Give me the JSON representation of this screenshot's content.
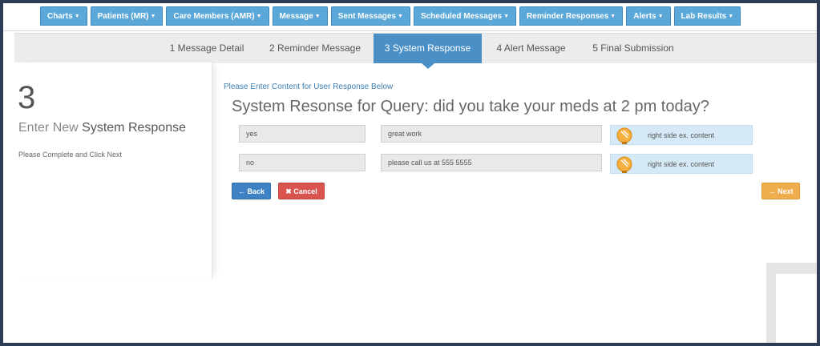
{
  "nav": {
    "items": [
      {
        "label": "Charts"
      },
      {
        "label": "Patients (MR)"
      },
      {
        "label": "Care Members (AMR)"
      },
      {
        "label": "Message"
      },
      {
        "label": "Sent Messages"
      },
      {
        "label": "Scheduled Messages"
      },
      {
        "label": "Reminder Responses"
      },
      {
        "label": "Alerts"
      },
      {
        "label": "Lab Results"
      }
    ]
  },
  "steps": [
    {
      "label": "1 Message Detail"
    },
    {
      "label": "2 Reminder Message"
    },
    {
      "label": "3 System Response",
      "active": true
    },
    {
      "label": "4 Alert Message"
    },
    {
      "label": "5 Final Submission"
    }
  ],
  "left": {
    "step_number": "3",
    "title_light": "Enter New",
    "title_bold": "System Response",
    "note": "Please Complete and Click Next"
  },
  "main": {
    "instruction": "Please Enter Content for User Response Below",
    "heading": "System Resonse for Query: did you take your meds at 2 pm today?",
    "rows": [
      {
        "response": "yes",
        "reply": "great work",
        "side_text": "right side ex. content"
      },
      {
        "response": "no",
        "reply": "please call us at 555 5555",
        "side_text": "right side ex. content"
      }
    ]
  },
  "buttons": {
    "back": "Back",
    "cancel": "Cancel",
    "next": "Next"
  },
  "colors": {
    "nav_tab": "#5aa7d8",
    "step_active": "#4a8fc5",
    "back_button": "#3e82c3",
    "cancel_button": "#d9534f",
    "next_button": "#f0ad4e",
    "side_panel": "#d5e9f6"
  }
}
